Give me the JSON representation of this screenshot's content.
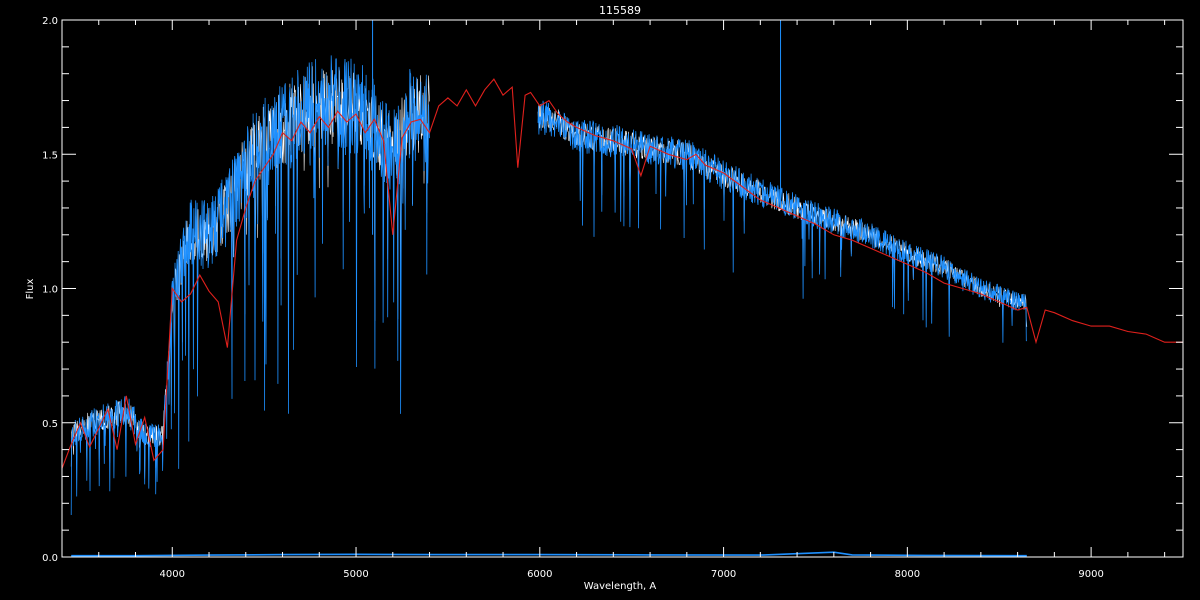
{
  "chart_data": {
    "type": "line",
    "title": "115589",
    "xlabel": "Wavelength, A",
    "ylabel": "Flux",
    "xlim": [
      3400,
      9500
    ],
    "ylim": [
      0.0,
      2.0
    ],
    "x_ticks": [
      4000,
      5000,
      6000,
      7000,
      8000,
      9000
    ],
    "x_tick_labels": [
      "4000",
      "5000",
      "6000",
      "7000",
      "8000",
      "9000"
    ],
    "y_ticks": [
      0.0,
      0.5,
      1.0,
      1.5,
      2.0
    ],
    "y_tick_labels": [
      "0.0",
      "0.5",
      "1.0",
      "1.5",
      "2.0"
    ],
    "grid": false,
    "colors": {
      "background": "#000000",
      "axes": "#ffffff",
      "observed": "#ffffff",
      "model": "#1e90ff",
      "smooth": "#e0201c",
      "error": "#1e90ff"
    },
    "series": [
      {
        "key": "smooth",
        "points": [
          [
            3400,
            0.33
          ],
          [
            3450,
            0.42
          ],
          [
            3500,
            0.5
          ],
          [
            3550,
            0.41
          ],
          [
            3600,
            0.48
          ],
          [
            3650,
            0.55
          ],
          [
            3700,
            0.4
          ],
          [
            3750,
            0.6
          ],
          [
            3800,
            0.42
          ],
          [
            3850,
            0.52
          ],
          [
            3900,
            0.36
          ],
          [
            3950,
            0.4
          ],
          [
            4000,
            1.0
          ],
          [
            4050,
            0.95
          ],
          [
            4100,
            0.98
          ],
          [
            4150,
            1.05
          ],
          [
            4200,
            0.99
          ],
          [
            4250,
            0.95
          ],
          [
            4300,
            0.78
          ],
          [
            4350,
            1.18
          ],
          [
            4400,
            1.3
          ],
          [
            4450,
            1.4
          ],
          [
            4500,
            1.45
          ],
          [
            4550,
            1.5
          ],
          [
            4600,
            1.58
          ],
          [
            4650,
            1.55
          ],
          [
            4700,
            1.62
          ],
          [
            4750,
            1.58
          ],
          [
            4800,
            1.64
          ],
          [
            4850,
            1.6
          ],
          [
            4900,
            1.66
          ],
          [
            4950,
            1.62
          ],
          [
            5000,
            1.65
          ],
          [
            5050,
            1.58
          ],
          [
            5100,
            1.63
          ],
          [
            5150,
            1.55
          ],
          [
            5200,
            1.2
          ],
          [
            5250,
            1.56
          ],
          [
            5300,
            1.62
          ],
          [
            5350,
            1.63
          ],
          [
            5400,
            1.58
          ],
          [
            5450,
            1.68
          ],
          [
            5500,
            1.71
          ],
          [
            5550,
            1.68
          ],
          [
            5600,
            1.74
          ],
          [
            5650,
            1.68
          ],
          [
            5700,
            1.74
          ],
          [
            5750,
            1.78
          ],
          [
            5800,
            1.72
          ],
          [
            5850,
            1.75
          ],
          [
            5880,
            1.45
          ],
          [
            5920,
            1.72
          ],
          [
            5950,
            1.73
          ],
          [
            6000,
            1.68
          ],
          [
            6050,
            1.7
          ],
          [
            6100,
            1.65
          ],
          [
            6150,
            1.62
          ],
          [
            6200,
            1.6
          ],
          [
            6300,
            1.57
          ],
          [
            6400,
            1.55
          ],
          [
            6500,
            1.52
          ],
          [
            6550,
            1.42
          ],
          [
            6600,
            1.53
          ],
          [
            6700,
            1.5
          ],
          [
            6800,
            1.48
          ],
          [
            6850,
            1.5
          ],
          [
            6900,
            1.46
          ],
          [
            7000,
            1.43
          ],
          [
            7100,
            1.38
          ],
          [
            7200,
            1.33
          ],
          [
            7300,
            1.3
          ],
          [
            7400,
            1.27
          ],
          [
            7500,
            1.24
          ],
          [
            7600,
            1.2
          ],
          [
            7700,
            1.18
          ],
          [
            7800,
            1.15
          ],
          [
            7900,
            1.12
          ],
          [
            8000,
            1.09
          ],
          [
            8100,
            1.06
          ],
          [
            8200,
            1.02
          ],
          [
            8300,
            1.0
          ],
          [
            8400,
            0.98
          ],
          [
            8500,
            0.95
          ],
          [
            8600,
            0.92
          ],
          [
            8650,
            0.93
          ],
          [
            8700,
            0.8
          ],
          [
            8750,
            0.92
          ],
          [
            8800,
            0.91
          ],
          [
            8900,
            0.88
          ],
          [
            9000,
            0.86
          ],
          [
            9100,
            0.86
          ],
          [
            9200,
            0.84
          ],
          [
            9300,
            0.83
          ],
          [
            9400,
            0.8
          ],
          [
            9500,
            0.8
          ]
        ]
      },
      {
        "key": "error",
        "points": [
          [
            3450,
            0.005
          ],
          [
            3800,
            0.005
          ],
          [
            4200,
            0.007
          ],
          [
            4600,
            0.009
          ],
          [
            5000,
            0.01
          ],
          [
            5400,
            0.009
          ],
          [
            6000,
            0.009
          ],
          [
            6600,
            0.008
          ],
          [
            7200,
            0.007
          ],
          [
            7600,
            0.018
          ],
          [
            7700,
            0.008
          ],
          [
            8100,
            0.006
          ],
          [
            8650,
            0.005
          ]
        ]
      }
    ],
    "spectrum_segments": [
      {
        "range": [
          3450,
          5400
        ],
        "envelope": [
          [
            3450,
            0.45
          ],
          [
            3550,
            0.5
          ],
          [
            3650,
            0.52
          ],
          [
            3750,
            0.55
          ],
          [
            3850,
            0.45
          ],
          [
            3950,
            0.45
          ],
          [
            4000,
            0.98
          ],
          [
            4100,
            1.2
          ],
          [
            4200,
            1.2
          ],
          [
            4300,
            1.3
          ],
          [
            4400,
            1.45
          ],
          [
            4500,
            1.55
          ],
          [
            4600,
            1.6
          ],
          [
            4700,
            1.65
          ],
          [
            4800,
            1.7
          ],
          [
            4900,
            1.68
          ],
          [
            5000,
            1.68
          ],
          [
            5100,
            1.6
          ],
          [
            5200,
            1.5
          ],
          [
            5300,
            1.65
          ],
          [
            5400,
            1.65
          ]
        ]
      },
      {
        "range": [
          5990,
          8650
        ],
        "envelope": [
          [
            5990,
            1.64
          ],
          [
            6100,
            1.62
          ],
          [
            6200,
            1.57
          ],
          [
            6400,
            1.55
          ],
          [
            6600,
            1.52
          ],
          [
            6800,
            1.5
          ],
          [
            7000,
            1.42
          ],
          [
            7200,
            1.36
          ],
          [
            7400,
            1.3
          ],
          [
            7600,
            1.25
          ],
          [
            7800,
            1.2
          ],
          [
            8000,
            1.13
          ],
          [
            8200,
            1.08
          ],
          [
            8400,
            1.0
          ],
          [
            8600,
            0.95
          ],
          [
            8650,
            0.95
          ]
        ]
      }
    ],
    "spikes": [
      {
        "x": 5090,
        "top": 2.0,
        "bottom": 1.2
      },
      {
        "x": 7310,
        "top": 2.0,
        "bottom": 1.3
      }
    ]
  }
}
